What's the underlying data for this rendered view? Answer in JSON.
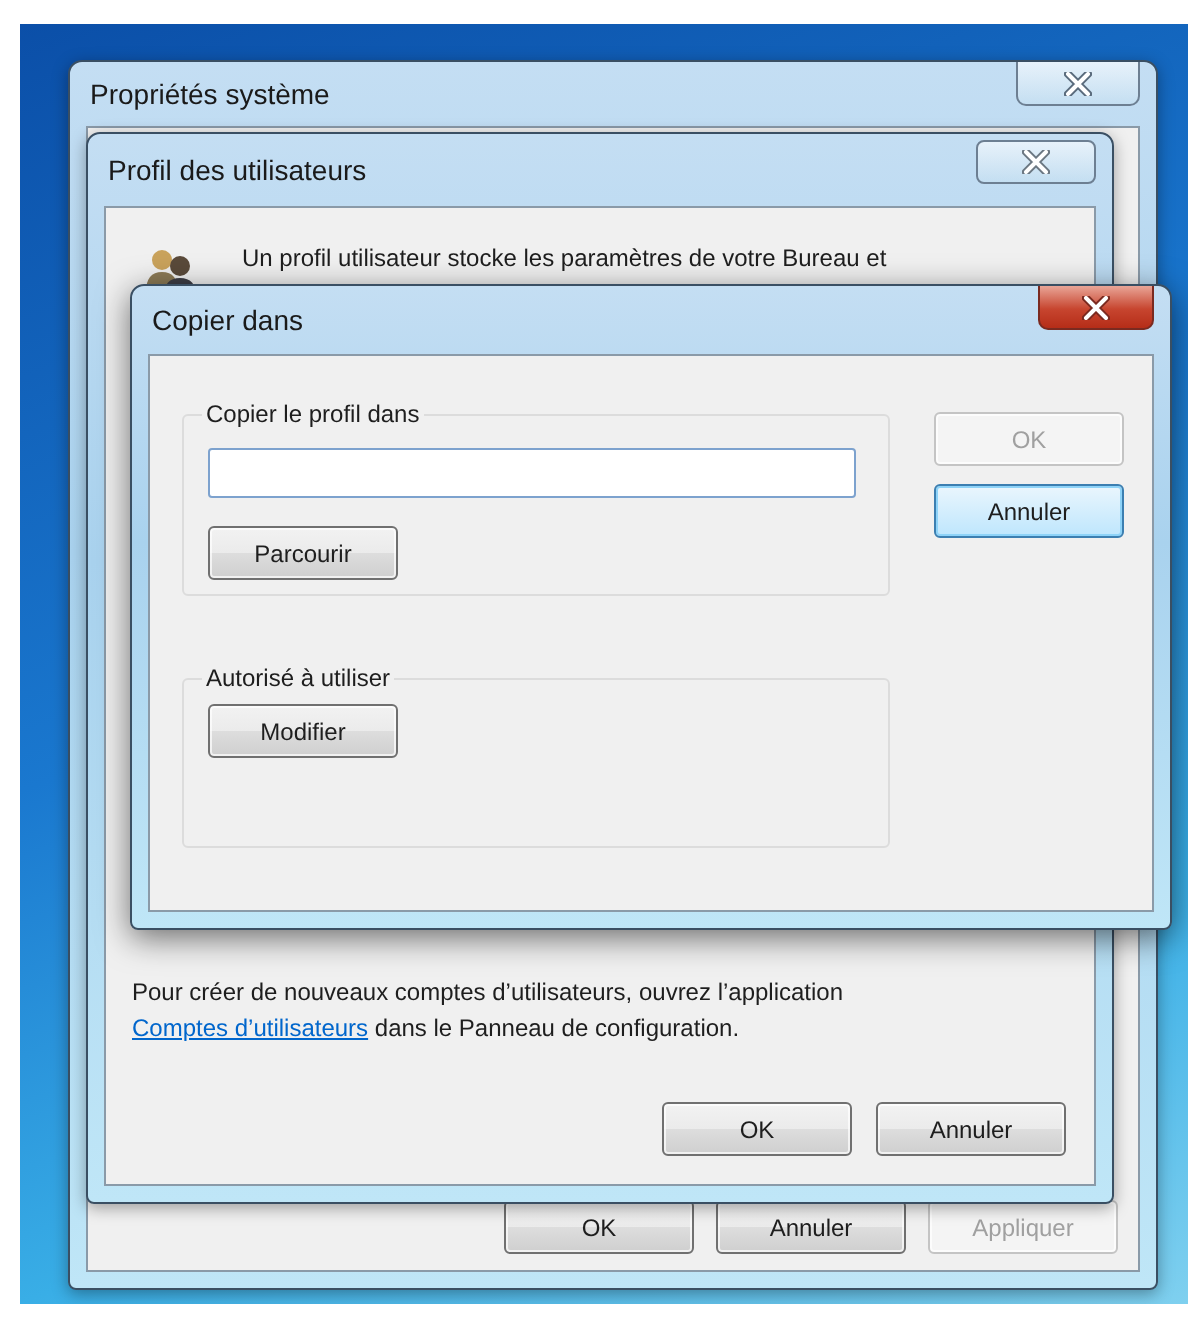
{
  "system_window": {
    "title": "Propriétés système",
    "buttons": [
      {
        "label": "OK",
        "disabled": false
      },
      {
        "label": "Annuler",
        "disabled": false
      },
      {
        "label": "Appliquer",
        "disabled": true
      }
    ]
  },
  "profile_window": {
    "title": "Profil des utilisateurs",
    "intro": "Un profil utilisateur stocke les paramètres de votre Bureau et",
    "footer": {
      "before": "Pour créer de nouveaux comptes d’utilisateurs, ouvrez l’application",
      "link": "Comptes d’utilisateurs",
      "after": " dans le Panneau de configuration."
    },
    "buttons": [
      {
        "label": "OK",
        "disabled": false
      },
      {
        "label": "Annuler",
        "disabled": false
      }
    ]
  },
  "copy_window": {
    "title": "Copier dans",
    "groups": [
      {
        "kind": "path",
        "legend": "Copier le profil dans",
        "button": "Parcourir"
      },
      {
        "kind": "permission",
        "legend": "Autorisé à utiliser",
        "button": "Modifier"
      }
    ],
    "buttons": [
      {
        "label": "OK",
        "disabled": true,
        "focused": false
      },
      {
        "label": "Annuler",
        "disabled": false,
        "focused": true
      }
    ]
  }
}
